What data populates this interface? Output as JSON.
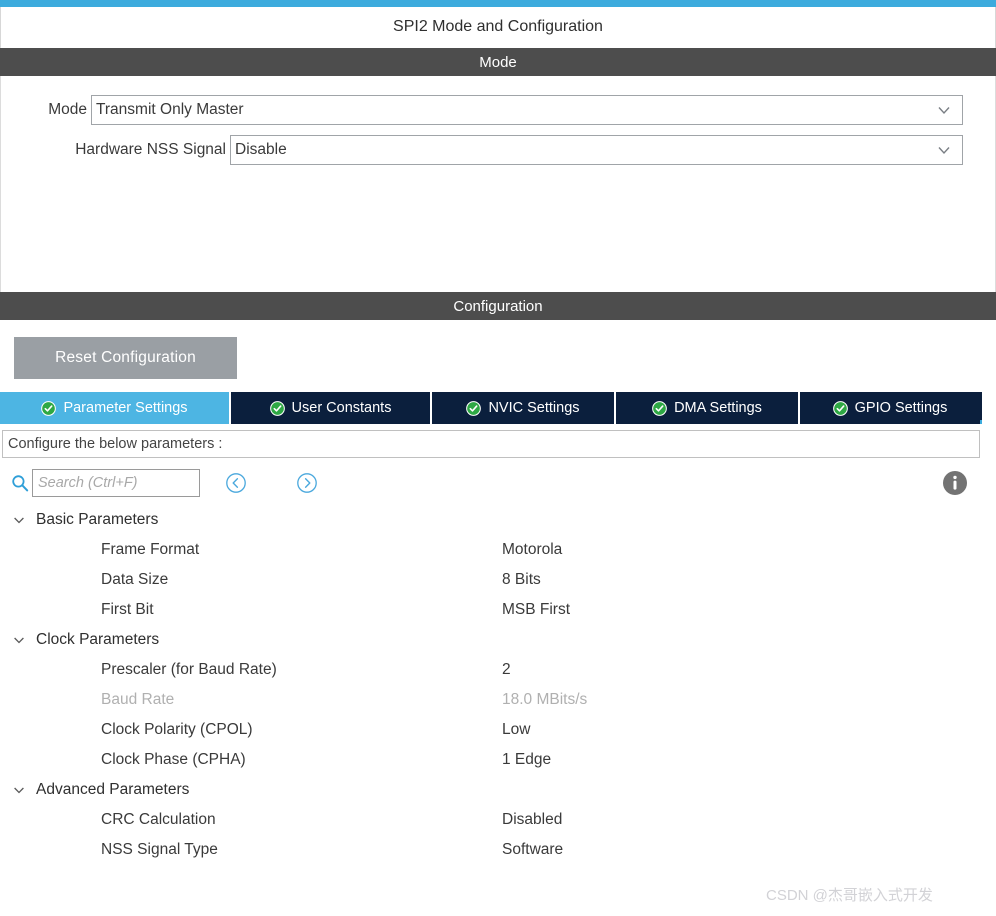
{
  "window": {
    "title": "SPI2 Mode and Configuration",
    "accent_color": "#3cabdd"
  },
  "mode_section": {
    "header": "Mode",
    "fields": [
      {
        "label": "Mode",
        "value": "Transmit Only Master",
        "control": "dropdown"
      },
      {
        "label": "Hardware NSS Signal",
        "value": "Disable",
        "control": "dropdown"
      }
    ]
  },
  "configuration_section": {
    "header": "Configuration",
    "reset_button": "Reset Configuration",
    "tabs": [
      {
        "label": "Parameter Settings",
        "active": true,
        "icon": "green-check-icon"
      },
      {
        "label": "User Constants",
        "active": false,
        "icon": "green-check-icon"
      },
      {
        "label": "NVIC Settings",
        "active": false,
        "icon": "green-check-icon"
      },
      {
        "label": "DMA Settings",
        "active": false,
        "icon": "green-check-icon"
      },
      {
        "label": "GPIO Settings",
        "active": false,
        "icon": "green-check-icon"
      }
    ],
    "hint": "Configure the below parameters :",
    "search": {
      "placeholder": "Search (Ctrl+F)",
      "value": ""
    },
    "groups": [
      {
        "label": "Basic Parameters",
        "expanded": true,
        "rows": [
          {
            "name": "Frame Format",
            "value": "Motorola",
            "disabled": false
          },
          {
            "name": "Data Size",
            "value": "8 Bits",
            "disabled": false
          },
          {
            "name": "First Bit",
            "value": "MSB First",
            "disabled": false
          }
        ]
      },
      {
        "label": "Clock Parameters",
        "expanded": true,
        "rows": [
          {
            "name": "Prescaler (for Baud Rate)",
            "value": "2",
            "disabled": false
          },
          {
            "name": "Baud Rate",
            "value": "18.0 MBits/s",
            "disabled": true
          },
          {
            "name": "Clock Polarity (CPOL)",
            "value": "Low",
            "disabled": false
          },
          {
            "name": "Clock Phase (CPHA)",
            "value": "1 Edge",
            "disabled": false
          }
        ]
      },
      {
        "label": "Advanced Parameters",
        "expanded": true,
        "rows": [
          {
            "name": "CRC Calculation",
            "value": "Disabled",
            "disabled": false
          },
          {
            "name": "NSS Signal Type",
            "value": "Software",
            "disabled": false
          }
        ]
      }
    ]
  },
  "watermark": "CSDN @杰哥嵌入式开发",
  "colors": {
    "accent": "#3cabdd",
    "tab_active_bg": "#4db5e3",
    "tab_inactive_bg": "#0b1f3d",
    "section_bar_bg": "#4d4d4d",
    "reset_btn_bg": "#9a9fa4",
    "check_green": "#22a03b"
  }
}
